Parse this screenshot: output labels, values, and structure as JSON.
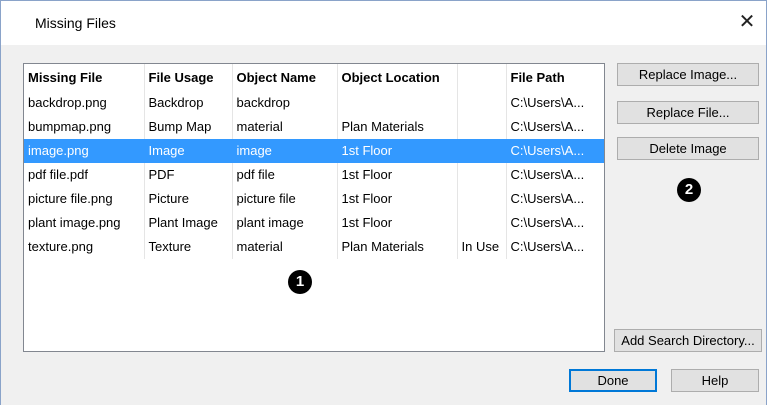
{
  "window": {
    "title": "Missing Files",
    "close_glyph": "✕"
  },
  "table": {
    "columns": [
      "Missing File",
      "File Usage",
      "Object Name",
      "Object Location",
      "",
      "File Path"
    ],
    "sort_indicator": "^",
    "rows": [
      {
        "cells": [
          "backdrop.png",
          "Backdrop",
          "backdrop",
          "",
          "",
          "C:\\Users\\A..."
        ],
        "selected": false
      },
      {
        "cells": [
          "bumpmap.png",
          "Bump Map",
          "material",
          "Plan Materials",
          "",
          "C:\\Users\\A..."
        ],
        "selected": false
      },
      {
        "cells": [
          "image.png",
          "Image",
          "image",
          "1st Floor",
          "",
          "C:\\Users\\A..."
        ],
        "selected": true
      },
      {
        "cells": [
          "pdf file.pdf",
          "PDF",
          "pdf file",
          "1st Floor",
          "",
          "C:\\Users\\A..."
        ],
        "selected": false
      },
      {
        "cells": [
          "picture file.png",
          "Picture",
          "picture file",
          "1st Floor",
          "",
          "C:\\Users\\A..."
        ],
        "selected": false
      },
      {
        "cells": [
          "plant image.png",
          "Plant Image",
          "plant image",
          "1st Floor",
          "",
          "C:\\Users\\A..."
        ],
        "selected": false
      },
      {
        "cells": [
          "texture.png",
          "Texture",
          "material",
          "Plan Materials",
          "In Use",
          "C:\\Users\\A..."
        ],
        "selected": false
      }
    ]
  },
  "buttons": {
    "replace_image": "Replace Image...",
    "replace_file": "Replace File...",
    "delete_image": "Delete Image",
    "add_search_directory": "Add Search Directory...",
    "done": "Done",
    "help": "Help"
  },
  "callouts": {
    "one": "1",
    "two": "2"
  },
  "colors": {
    "selection": "#3399ff",
    "default_button_border": "#0078d7"
  }
}
